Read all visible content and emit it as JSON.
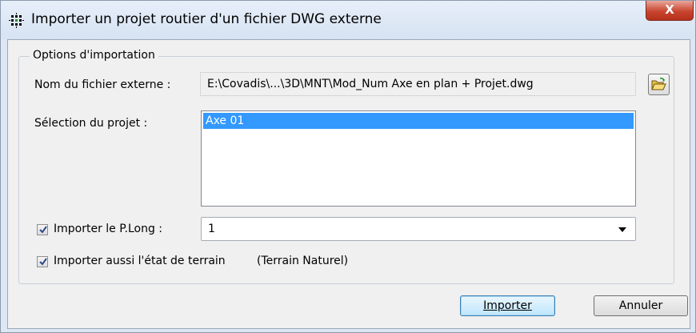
{
  "window": {
    "title": "Importer un projet routier d'un fichier DWG externe",
    "close_label": "X"
  },
  "options": {
    "group_title": "Options d'importation",
    "file_label": "Nom du fichier externe :",
    "file_value": "E:\\Covadis\\...\\3D\\MNT\\Mod_Num Axe en plan + Projet.dwg",
    "project_label": "Sélection du projet :",
    "projects": [
      "Axe 01"
    ],
    "import_plong_label": "Importer le P.Long :",
    "import_plong_checked": true,
    "plong_value": "1",
    "import_terrain_label": "Importer aussi l'état de terrain",
    "import_terrain_checked": true,
    "terrain_name": "(Terrain Naturel)"
  },
  "buttons": {
    "import_label": "Importer",
    "cancel_label": "Annuler"
  },
  "icons": {
    "app": "grid-app-icon",
    "browse": "open-folder-icon",
    "checkmark": "checkmark-icon",
    "dropdown": "dropdown-arrow-icon"
  },
  "colors": {
    "selection": "#3399ff",
    "close_button": "#c9452f",
    "title_bar": "#dde6f3"
  }
}
